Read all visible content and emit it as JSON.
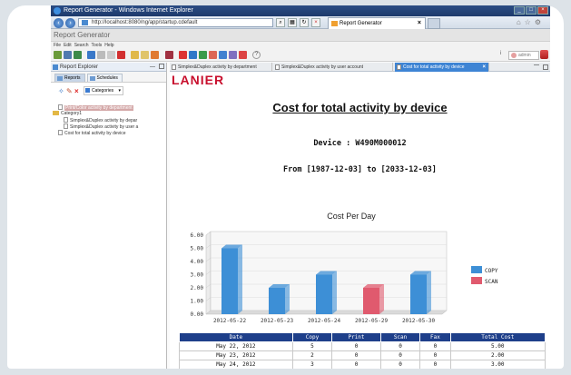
{
  "browser": {
    "title": "Report Generator - Windows Internet Explorer",
    "address": "http://localhost:8080/ng/app/startup.cdefault",
    "tab_label": "Report Generator"
  },
  "app": {
    "title": "Report Generator",
    "menu": [
      "File",
      "Edit",
      "Search",
      "Tools",
      "Help"
    ],
    "user": "admin"
  },
  "left_panel": {
    "title": "Report Explorer",
    "tabs": [
      "Reports",
      "Schedules"
    ],
    "categories_label": "Categories",
    "tree": [
      {
        "label": "Print/Color activity by department",
        "type": "doc",
        "selected": true,
        "indent": 1
      },
      {
        "label": "Category1",
        "type": "folder",
        "selected": false,
        "indent": 0
      },
      {
        "label": "Simplex&Duplex activity by depar",
        "type": "doc",
        "selected": false,
        "indent": 2
      },
      {
        "label": "Simplex&Duplex activity by user a",
        "type": "doc",
        "selected": false,
        "indent": 2
      },
      {
        "label": "Cost for total activity by device",
        "type": "doc",
        "selected": false,
        "indent": 1
      }
    ]
  },
  "right_panel": {
    "tabs": [
      {
        "label": "Simplex&Duplex activity by department",
        "active": false
      },
      {
        "label": "Simplex&Duplex activity by user account",
        "active": false
      },
      {
        "label": "Cost for total activity by device",
        "active": true
      }
    ]
  },
  "report": {
    "logo": "LANIER",
    "title": "Cost for total activity by device",
    "device_line": "Device : W490M000012",
    "range_line": "From [1987-12-03] to [2033-12-03]"
  },
  "chart_data": {
    "type": "bar",
    "title": "Cost Per Day",
    "categories": [
      "2012-05-22",
      "2012-05-23",
      "2012-05-24",
      "2012-05-29",
      "2012-05-30"
    ],
    "series": [
      {
        "name": "COPY",
        "values": [
          5.0,
          2.0,
          3.0,
          null,
          3.0
        ],
        "color": "#3d8fd6"
      },
      {
        "name": "SCAN",
        "values": [
          null,
          null,
          null,
          2.0,
          null
        ],
        "color": "#e05a6e"
      }
    ],
    "ytick_labels": [
      "0.00",
      "1.00",
      "2.00",
      "3.00",
      "4.00",
      "5.00",
      "6.00"
    ],
    "ylim": [
      0,
      6
    ],
    "legend": "right",
    "style": "3d"
  },
  "table": {
    "headers": [
      "Date",
      "Copy",
      "Print",
      "Scan",
      "Fax",
      "Total Cost"
    ],
    "rows": [
      [
        "May 22, 2012",
        "5",
        "0",
        "0",
        "0",
        "5.00"
      ],
      [
        "May 23, 2012",
        "2",
        "0",
        "0",
        "0",
        "2.00"
      ],
      [
        "May 24, 2012",
        "3",
        "0",
        "0",
        "0",
        "3.00"
      ]
    ]
  }
}
